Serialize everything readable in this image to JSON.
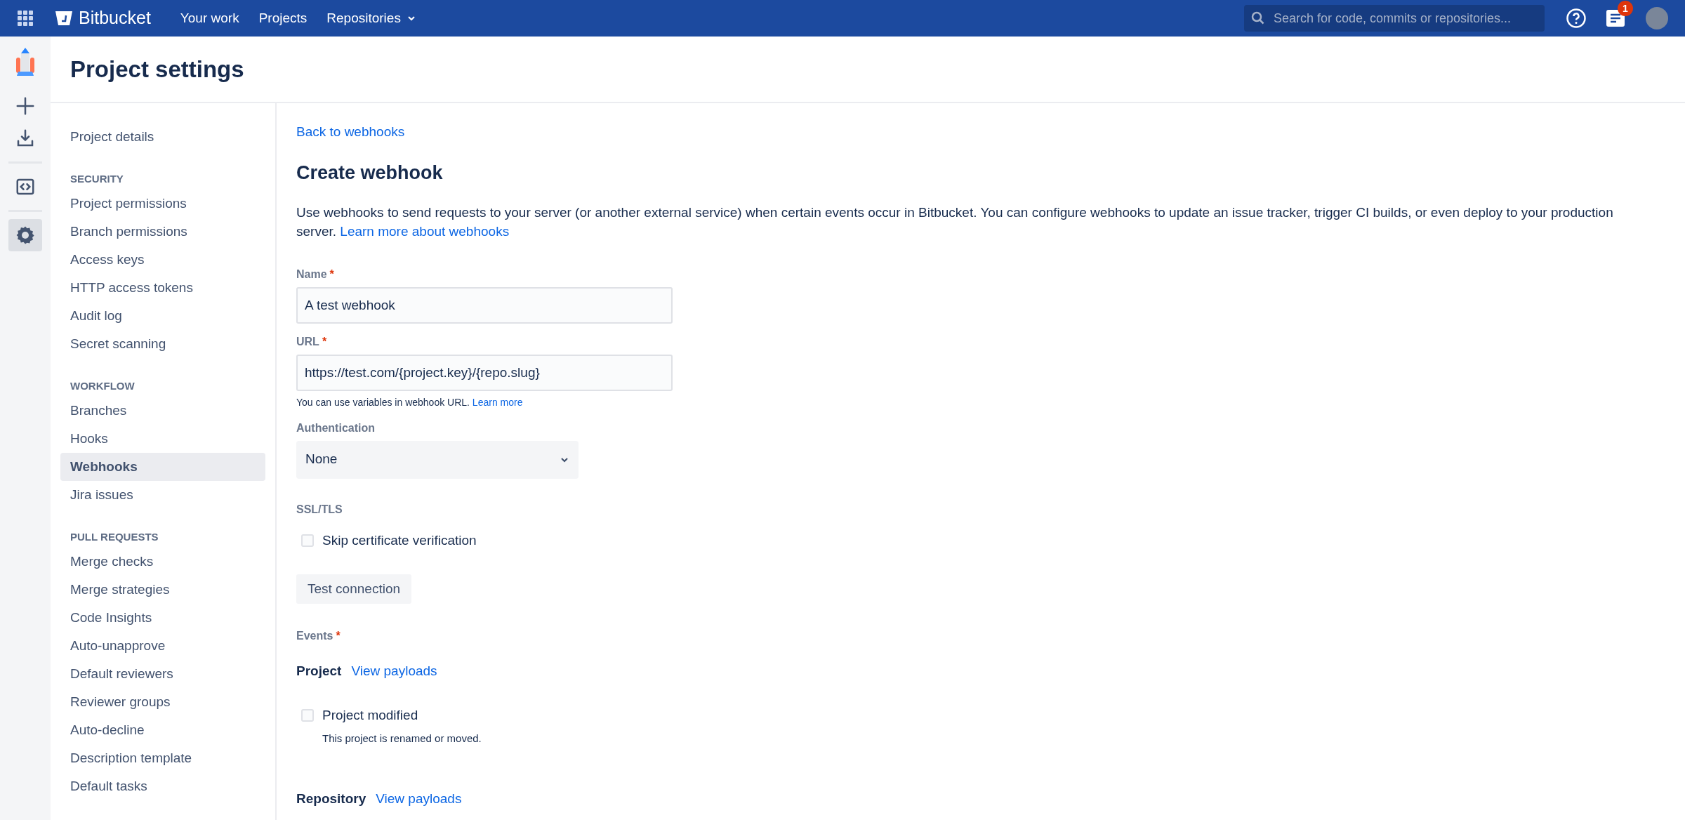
{
  "topbar": {
    "product": "Bitbucket",
    "nav": [
      {
        "label": "Your work",
        "dropdown": false
      },
      {
        "label": "Projects",
        "dropdown": false
      },
      {
        "label": "Repositories",
        "dropdown": true
      }
    ],
    "search": {
      "placeholder": "Search for code, commits or repositories..."
    },
    "notification_count": "1"
  },
  "rail": {
    "items": [
      {
        "kind": "create",
        "selected": false
      },
      {
        "kind": "import",
        "selected": false
      },
      {
        "kind": "code",
        "selected": false
      },
      {
        "kind": "settings",
        "selected": true
      }
    ]
  },
  "page_title": "Project settings",
  "sidebar": {
    "top_items": [
      {
        "label": "Project details",
        "selected": false
      }
    ],
    "sections": [
      {
        "heading": "SECURITY",
        "items": [
          {
            "label": "Project permissions",
            "selected": false
          },
          {
            "label": "Branch permissions",
            "selected": false
          },
          {
            "label": "Access keys",
            "selected": false
          },
          {
            "label": "HTTP access tokens",
            "selected": false
          },
          {
            "label": "Audit log",
            "selected": false
          },
          {
            "label": "Secret scanning",
            "selected": false
          }
        ]
      },
      {
        "heading": "WORKFLOW",
        "items": [
          {
            "label": "Branches",
            "selected": false
          },
          {
            "label": "Hooks",
            "selected": false
          },
          {
            "label": "Webhooks",
            "selected": true
          },
          {
            "label": "Jira issues",
            "selected": false
          }
        ]
      },
      {
        "heading": "PULL REQUESTS",
        "items": [
          {
            "label": "Merge checks",
            "selected": false
          },
          {
            "label": "Merge strategies",
            "selected": false
          },
          {
            "label": "Code Insights",
            "selected": false
          },
          {
            "label": "Auto-unapprove",
            "selected": false
          },
          {
            "label": "Default reviewers",
            "selected": false
          },
          {
            "label": "Reviewer groups",
            "selected": false
          },
          {
            "label": "Auto-decline",
            "selected": false
          },
          {
            "label": "Description template",
            "selected": false
          },
          {
            "label": "Default tasks",
            "selected": false
          }
        ]
      }
    ]
  },
  "form": {
    "back_link": "Back to webhooks",
    "title": "Create webhook",
    "description": {
      "text": "Use webhooks to send requests to your server (or another external service) when certain events occur in Bitbucket. You can configure webhooks to update an issue tracker, trigger CI builds, or even deploy to your production server.",
      "link": "Learn more about webhooks"
    },
    "name": {
      "label": "Name",
      "required_mark": "*",
      "value": "A test webhook"
    },
    "url": {
      "label": "URL",
      "required_mark": "*",
      "value": "https://test.com/{project.key}/{repo.slug}",
      "help": "You can use variables in webhook URL.",
      "help_link": "Learn more"
    },
    "authentication": {
      "label": "Authentication",
      "value": "None"
    },
    "ssl": {
      "label": "SSL/TLS",
      "option": {
        "label": "Skip certificate verification",
        "checked": false
      }
    },
    "test_button": "Test connection",
    "events": {
      "label": "Events",
      "required_mark": "*",
      "groups": [
        {
          "title": "Project",
          "link": "View payloads",
          "events": [
            {
              "label": "Project modified",
              "description": "This project is renamed or moved.",
              "checked": false
            }
          ]
        },
        {
          "title": "Repository",
          "link": "View payloads"
        }
      ]
    }
  }
}
